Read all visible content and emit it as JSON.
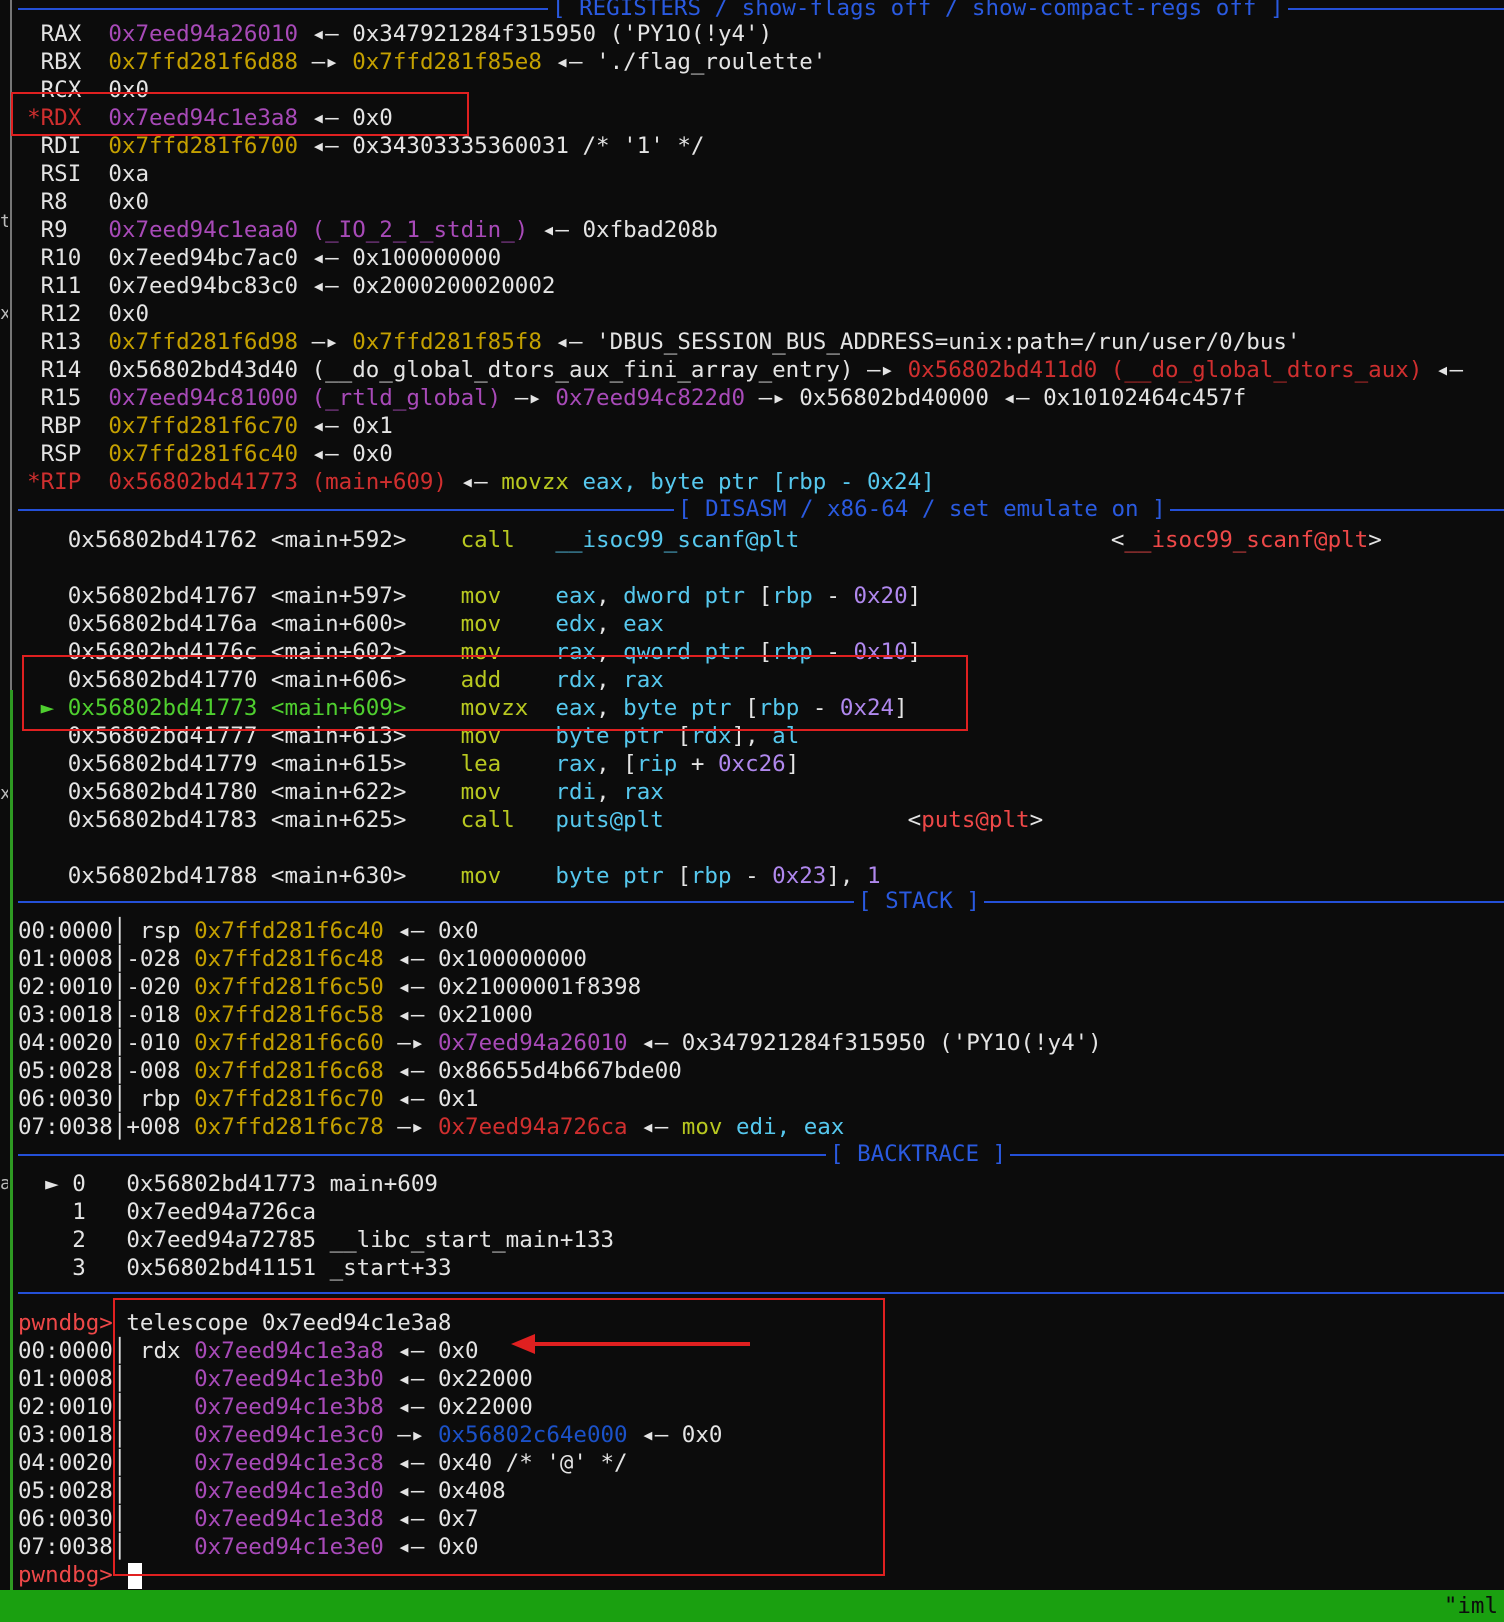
{
  "headers": {
    "registers": "[ REGISTERS / show-flags off / show-compact-regs off ]",
    "disasm": "[ DISASM / x86-64 / set emulate on ]",
    "stack": "[ STACK ]",
    "backtrace": "[ BACKTRACE ]"
  },
  "registers": {
    "rax": {
      "mark": " ",
      "name": "RAX",
      "addr": "0x7eed94a26010",
      "arrow1": " ◂— ",
      "v1": "0x347921284f315950 ('PY1O(!y4')"
    },
    "rbx": {
      "name": "RBX",
      "addr": "0x7ffd281f6d88",
      "a1": " —▸ ",
      "v1": "0x7ffd281f85e8",
      "a2": " ◂— ",
      "v2": "'./flag_roulette'"
    },
    "rcx": {
      "name": "RCX",
      "val": "0x0"
    },
    "rdx": {
      "mark": "*",
      "name": "RDX",
      "addr": "0x7eed94c1e3a8",
      "a1": " ◂— ",
      "v1": "0x0"
    },
    "rdi": {
      "name": "RDI",
      "addr": "0x7ffd281f6700",
      "a1": " ◂— ",
      "v1": "0x34303335360031 /* '1' */"
    },
    "rsi": {
      "name": "RSI",
      "val": "0xa"
    },
    "r8": {
      "name": "R8",
      "val": "0x0"
    },
    "r9": {
      "name": "R9",
      "addr": "0x7eed94c1eaa0 (_IO_2_1_stdin_)",
      "a1": " ◂— ",
      "v1": "0xfbad208b"
    },
    "r10": {
      "name": "R10",
      "addr": "0x7eed94bc7ac0",
      "a1": " ◂— ",
      "v1": "0x100000000"
    },
    "r11": {
      "name": "R11",
      "addr": "0x7eed94bc83c0",
      "a1": " ◂— ",
      "v1": "0x2000200020002"
    },
    "r12": {
      "name": "R12",
      "val": "0x0"
    },
    "r13": {
      "name": "R13",
      "addr": "0x7ffd281f6d98",
      "a1": " —▸ ",
      "v1": "0x7ffd281f85f8",
      "a2": " ◂— ",
      "v2": "'DBUS_SESSION_BUS_ADDRESS=unix:path=/run/user/0/bus'"
    },
    "r14": {
      "name": "R14",
      "addr": "0x56802bd43d40 (__do_global_dtors_aux_fini_array_entry)",
      "a1": " —▸ ",
      "v1": "0x56802bd411d0 (__do_global_dtors_aux)",
      "a2": " ◂—"
    },
    "r15": {
      "name": "R15",
      "addr": "0x7eed94c81000 (_rtld_global)",
      "a1": " —▸ ",
      "v1": "0x7eed94c822d0",
      "a2": " —▸ ",
      "v2": "0x56802bd40000",
      "a3": " ◂— ",
      "v3": "0x10102464c457f"
    },
    "rbp": {
      "name": "RBP",
      "addr": "0x7ffd281f6c70",
      "a1": " ◂— ",
      "v1": "0x1"
    },
    "rsp": {
      "name": "RSP",
      "addr": "0x7ffd281f6c40",
      "a1": " ◂— ",
      "v1": "0x0"
    },
    "rip": {
      "mark": "*",
      "name": "RIP",
      "addr": "0x56802bd41773 (main+609)",
      "a1": " ◂— ",
      "mn": "movzx",
      "ops": "eax, byte ptr [rbp - 0x24]"
    }
  },
  "disasm": [
    {
      "addr": "0x56802bd41762",
      "off": "<main+592>",
      "mn": "call",
      "op": "__isoc99_scanf@plt",
      "target": "<__isoc99_scanf@plt>"
    },
    {
      "addr": "0x56802bd41767",
      "off": "<main+597>",
      "mn": "mov",
      "op": "eax, dword ptr [rbp - 0x20]"
    },
    {
      "addr": "0x56802bd4176a",
      "off": "<main+600>",
      "mn": "mov",
      "op": "edx, eax"
    },
    {
      "addr": "0x56802bd4176c",
      "off": "<main+602>",
      "mn": "mov",
      "op": "rax, qword ptr [rbp - 0x10]"
    },
    {
      "addr": "0x56802bd41770",
      "off": "<main+606>",
      "mn": "add",
      "op": "rdx, rax"
    },
    {
      "addr": "0x56802bd41773",
      "off": "<main+609>",
      "mn": "movzx",
      "op": "eax, byte ptr [rbp - 0x24]",
      "current": "►"
    },
    {
      "addr": "0x56802bd41777",
      "off": "<main+613>",
      "mn": "mov",
      "op": "byte ptr [rdx], al"
    },
    {
      "addr": "0x56802bd41779",
      "off": "<main+615>",
      "mn": "lea",
      "op": "rax, [rip + 0xc26]"
    },
    {
      "addr": "0x56802bd41780",
      "off": "<main+622>",
      "mn": "mov",
      "op": "rdi, rax"
    },
    {
      "addr": "0x56802bd41783",
      "off": "<main+625>",
      "mn": "call",
      "op": "puts@plt",
      "target": "<puts@plt>"
    },
    {
      "addr": "0x56802bd41788",
      "off": "<main+630>",
      "mn": "mov",
      "op": "byte ptr [rbp - 0x23], 1"
    }
  ],
  "stack": [
    {
      "idx": "00:0000",
      "reg": " rsp",
      "addr": "0x7ffd281f6c40",
      "a1": " ◂— ",
      "v1": "0x0"
    },
    {
      "idx": "01:0008",
      "reg": "-028",
      "addr": "0x7ffd281f6c48",
      "a1": " ◂— ",
      "v1": "0x100000000"
    },
    {
      "idx": "02:0010",
      "reg": "-020",
      "addr": "0x7ffd281f6c50",
      "a1": " ◂— ",
      "v1": "0x21000001f8398"
    },
    {
      "idx": "03:0018",
      "reg": "-018",
      "addr": "0x7ffd281f6c58",
      "a1": " ◂— ",
      "v1": "0x21000"
    },
    {
      "idx": "04:0020",
      "reg": "-010",
      "addr": "0x7ffd281f6c60",
      "a1": " —▸ ",
      "p1": "0x7eed94a26010",
      "a2": " ◂— ",
      "v1": "0x347921284f315950 ('PY1O(!y4')"
    },
    {
      "idx": "05:0028",
      "reg": "-008",
      "addr": "0x7ffd281f6c68",
      "a1": " ◂— ",
      "v1": "0x86655d4b667bde00"
    },
    {
      "idx": "06:0030",
      "reg": " rbp",
      "addr": "0x7ffd281f6c70",
      "a1": " ◂— ",
      "v1": "0x1"
    },
    {
      "idx": "07:0038",
      "reg": "+008",
      "addr": "0x7ffd281f6c78",
      "a1": " —▸ ",
      "p1": "0x7eed94a726ca",
      "a2": " ◂— ",
      "mn": "mov",
      "ops": "edi, eax"
    }
  ],
  "backtrace": [
    {
      "mark": "►",
      "n": "0",
      "addr": "0x56802bd41773",
      "sym": "main+609"
    },
    {
      "mark": " ",
      "n": "1",
      "addr": "0x7eed94a726ca",
      "sym": ""
    },
    {
      "mark": " ",
      "n": "2",
      "addr": "0x7eed94a72785",
      "sym": "__libc_start_main+133"
    },
    {
      "mark": " ",
      "n": "3",
      "addr": "0x56802bd41151",
      "sym": "_start+33"
    }
  ],
  "telescope": {
    "prompt": "pwndbg>",
    "cmd": " telescope 0x7eed94c1e3a8",
    "rows": [
      {
        "idx": "00:0000",
        "reg": " rdx",
        "addr": "0x7eed94c1e3a8",
        "a1": " ◂— ",
        "v1": "0x0"
      },
      {
        "idx": "01:0008",
        "reg": "    ",
        "addr": "0x7eed94c1e3b0",
        "a1": " ◂— ",
        "v1": "0x22000"
      },
      {
        "idx": "02:0010",
        "reg": "    ",
        "addr": "0x7eed94c1e3b8",
        "a1": " ◂— ",
        "v1": "0x22000"
      },
      {
        "idx": "03:0018",
        "reg": "    ",
        "addr": "0x7eed94c1e3c0",
        "a1": " —▸ ",
        "p1": "0x56802c64e000",
        "a2": " ◂— ",
        "v1": "0x0"
      },
      {
        "idx": "04:0020",
        "reg": "    ",
        "addr": "0x7eed94c1e3c8",
        "a1": " ◂— ",
        "v1": "0x40 /* '@' */"
      },
      {
        "idx": "05:0028",
        "reg": "    ",
        "addr": "0x7eed94c1e3d0",
        "a1": " ◂— ",
        "v1": "0x408"
      },
      {
        "idx": "06:0030",
        "reg": "    ",
        "addr": "0x7eed94c1e3d8",
        "a1": " ◂— ",
        "v1": "0x7"
      },
      {
        "idx": "07:0038",
        "reg": "    ",
        "addr": "0x7eed94c1e3e0",
        "a1": " ◂— ",
        "v1": "0x0"
      }
    ],
    "prompt2": "pwndbg>"
  },
  "statusbar": {
    "text": "\"iml"
  },
  "colors": {
    "highlight_box": "#e02020",
    "header": "#2450d8",
    "status_bar": "#1aa010"
  }
}
